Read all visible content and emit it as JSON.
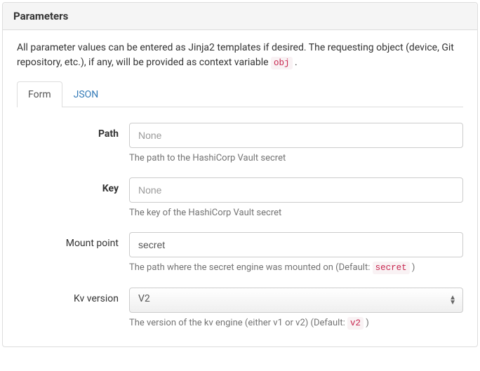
{
  "panel": {
    "title": "Parameters"
  },
  "description": {
    "text_before": "All parameter values can be entered as Jinja2 templates if desired. The requesting object (device, Git repository, etc.), if any, will be provided as context variable ",
    "code": "obj",
    "text_after": " ."
  },
  "tabs": {
    "form": "Form",
    "json": "JSON"
  },
  "fields": {
    "path": {
      "label": "Path",
      "placeholder": "None",
      "help": "The path to the HashiCorp Vault secret"
    },
    "key": {
      "label": "Key",
      "placeholder": "None",
      "help": "The key of the HashiCorp Vault secret"
    },
    "mount_point": {
      "label": "Mount point",
      "value": "secret",
      "help_before": "The path where the secret engine was mounted on (Default: ",
      "help_code": "secret",
      "help_after": " )"
    },
    "kv_version": {
      "label": "Kv version",
      "value": "V2",
      "help_before": "The version of the kv engine (either v1 or v2) (Default: ",
      "help_code": "v2",
      "help_after": " )"
    }
  }
}
